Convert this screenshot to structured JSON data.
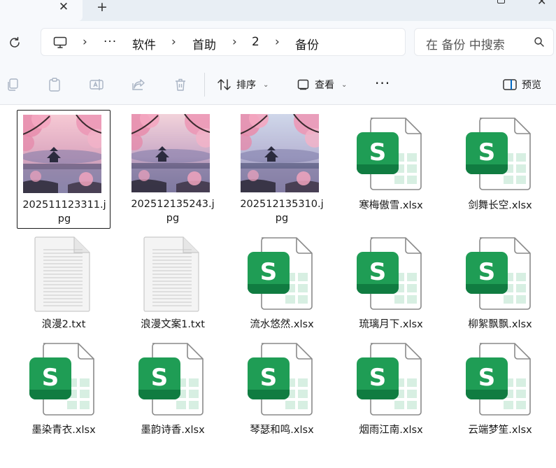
{
  "window": {
    "tab_close_glyph": "✕",
    "tab_new_glyph": "+",
    "win_close_glyph": "✕"
  },
  "address_bar": {
    "breadcrumbs": [
      "软件",
      "首助",
      "2",
      "备份"
    ],
    "overflow_label": "···",
    "separator": "›"
  },
  "search": {
    "placeholder": "在 备份 中搜索"
  },
  "toolbar": {
    "sort_label": "排序",
    "view_label": "查看",
    "more_label": "···",
    "preview_label": "预览"
  },
  "colors": {
    "excel_green": "#1f9d55",
    "excel_dark": "#107c41",
    "accent": "#0067c0"
  },
  "files": [
    {
      "name": "202511123311.jpg",
      "type": "image",
      "selected": true,
      "scene": 1
    },
    {
      "name": "202512135243.jpg",
      "type": "image",
      "selected": false,
      "scene": 2
    },
    {
      "name": "202512135310.jpg",
      "type": "image",
      "selected": false,
      "scene": 3
    },
    {
      "name": "寒梅傲雪.xlsx",
      "type": "xlsx",
      "selected": false
    },
    {
      "name": "剑舞长空.xlsx",
      "type": "xlsx",
      "selected": false
    },
    {
      "name": "浪漫2.txt",
      "type": "txt",
      "selected": false
    },
    {
      "name": "浪漫文案1.txt",
      "type": "txt",
      "selected": false
    },
    {
      "name": "流水悠然.xlsx",
      "type": "xlsx",
      "selected": false
    },
    {
      "name": "琉璃月下.xlsx",
      "type": "xlsx",
      "selected": false
    },
    {
      "name": "柳絮飘飘.xlsx",
      "type": "xlsx",
      "selected": false
    },
    {
      "name": "墨染青衣.xlsx",
      "type": "xlsx",
      "selected": false
    },
    {
      "name": "墨韵诗香.xlsx",
      "type": "xlsx",
      "selected": false
    },
    {
      "name": "琴瑟和鸣.xlsx",
      "type": "xlsx",
      "selected": false
    },
    {
      "name": "烟雨江南.xlsx",
      "type": "xlsx",
      "selected": false
    },
    {
      "name": "云端梦笙.xlsx",
      "type": "xlsx",
      "selected": false
    }
  ],
  "xlsx_icon_letter": "S"
}
